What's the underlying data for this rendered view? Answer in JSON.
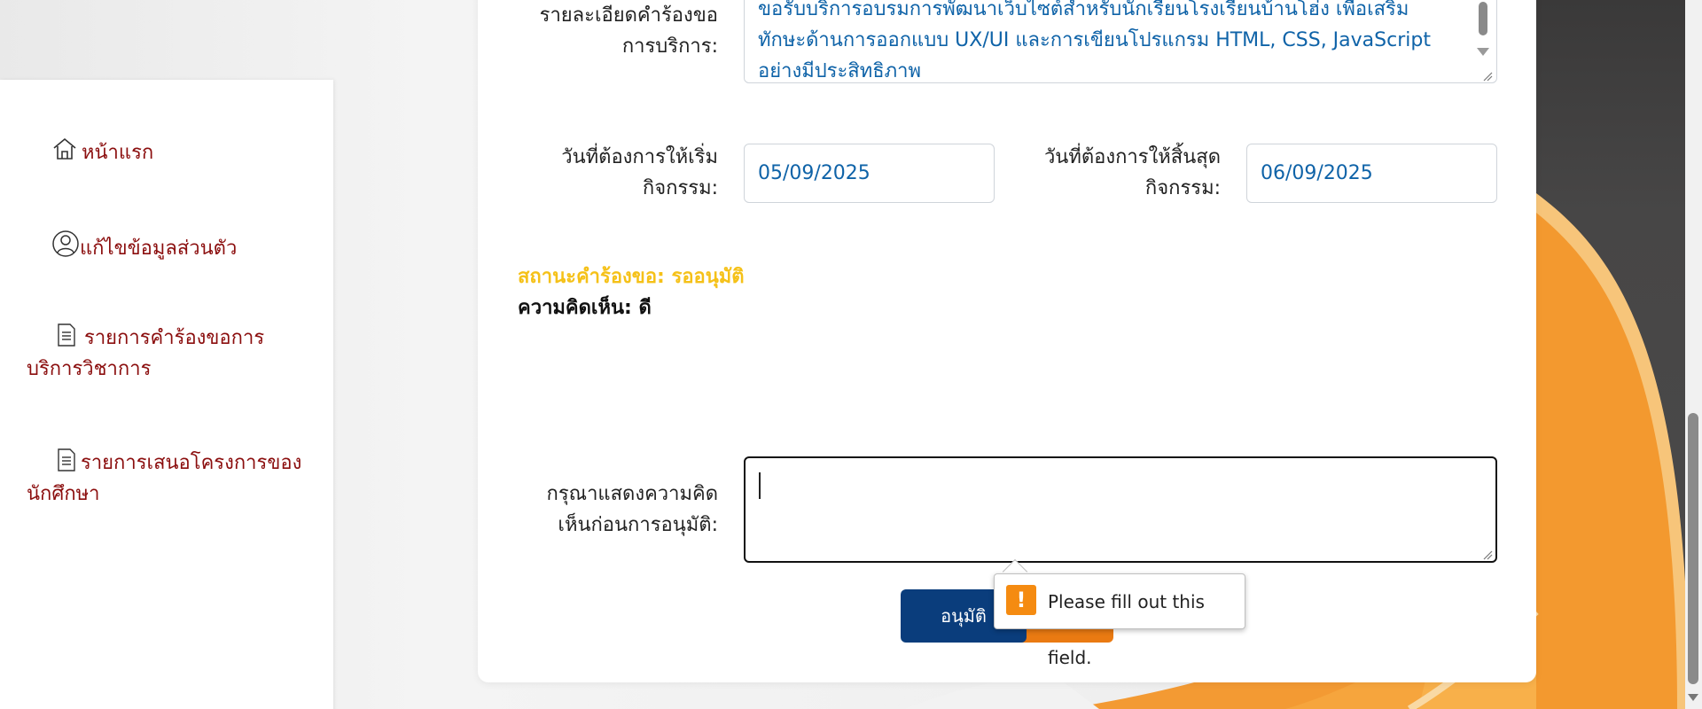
{
  "sidebar": {
    "items": [
      {
        "label": "หน้าแรก",
        "icon": "home-icon"
      },
      {
        "label": "แก้ไขข้อมูลส่วนตัว",
        "icon": "user-circle-icon"
      },
      {
        "label": "รายการคำร้องขอการ",
        "label2": "บริการวิชาการ",
        "icon": "document-list-icon"
      },
      {
        "label": "รายการเสนอโครงการของ",
        "label2": "นักศึกษา",
        "icon": "document-list-icon"
      }
    ]
  },
  "form": {
    "detail_label_1": "รายละเอียดคำร้องขอ",
    "detail_label_2": "การบริการ:",
    "detail_text": "ขอรับบริการอบรมการพัฒนาเว็บไซต์สำหรับนักเรียนโรงเรียนบ้านโฮ่ง เพื่อเสริมทักษะด้านการออกแบบ UX/UI และการเขียนโปรแกรม HTML, CSS, JavaScript อย่างมีประสิทธิภาพ",
    "start_label_1": "วันที่ต้องการให้เริ่ม",
    "start_label_2": "กิจกรรม:",
    "start_date": "05/09/2025",
    "end_label_1": "วันที่ต้องการให้สิ้นสุด",
    "end_label_2": "กิจกรรม:",
    "end_date": "06/09/2025",
    "status_text": "สถานะคำร้องขอ: รออนุมัติ",
    "comment_text": "ความคิดเห็น: ดี",
    "input_label_1": "กรุณาแสดงความคิด",
    "input_label_2": "เห็นก่อนการอนุมัติ:",
    "comment_value": "",
    "approve_label": "อนุมัติ",
    "reject_label": ""
  },
  "validation": {
    "message": "Please fill out this field.",
    "icon": "warning-icon"
  },
  "colors": {
    "nav_text": "#8b0e0e",
    "status": "#f5c118",
    "approve": "#0a3d7c",
    "reject": "#ea7a12",
    "input_text": "#0f63a8"
  }
}
